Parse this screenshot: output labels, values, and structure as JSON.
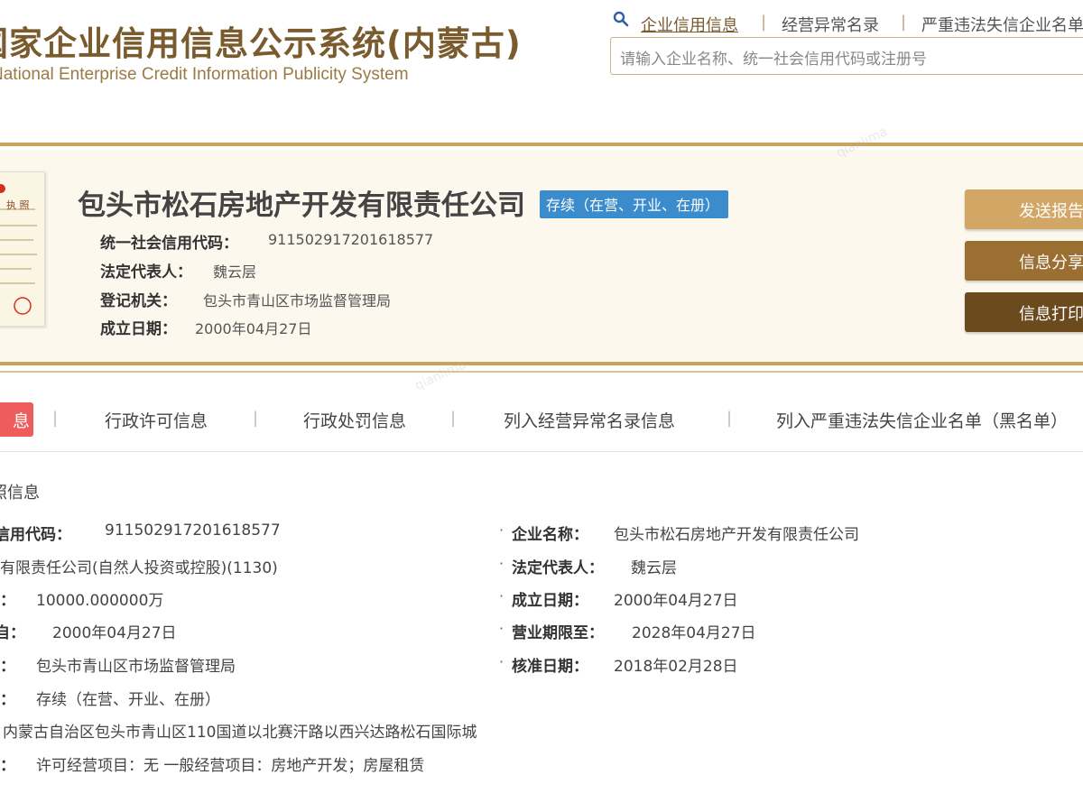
{
  "header": {
    "title": "国家企业信用信息公示系统(内蒙古)",
    "subtitle": "National Enterprise Credit Information Publicity System",
    "nav": [
      "企业信用信息",
      "经营异常名录",
      "严重违法失信企业名单"
    ],
    "search_placeholder": "请输入企业名称、统一社会信用代码或注册号"
  },
  "company": {
    "name": "包头市松石房地产开发有限责任公司",
    "status": "存续（在营、开业、在册）",
    "fields": [
      {
        "label": "统一社会信用代码：",
        "value": "911502917201618577"
      },
      {
        "label": "法定代表人：",
        "value": "魏云层"
      },
      {
        "label": "登记机关：",
        "value": "包头市青山区市场监督管理局"
      },
      {
        "label": "成立日期：",
        "value": "2000年04月27日"
      }
    ],
    "license_thumb_label": "执 照"
  },
  "actions": [
    {
      "label": "发送报告",
      "color": "#d2a766"
    },
    {
      "label": "信息分享",
      "color": "#9b6e32"
    },
    {
      "label": "信息打印",
      "color": "#6b4a1e"
    }
  ],
  "tabs": {
    "active": "息",
    "items": [
      "行政许可信息",
      "行政处罚信息",
      "列入经营异常名录信息",
      "列入严重违法失信企业名单（黑名单）"
    ]
  },
  "details": {
    "section_title": "照信息",
    "left": [
      {
        "label": "信用代码：",
        "value": "911502917201618577"
      },
      {
        "label": "",
        "value": "有限责任公司(自然人投资或控股)(1130)"
      },
      {
        "label": "：",
        "value": "10000.000000万"
      },
      {
        "label": "自：",
        "value": "2000年04月27日"
      },
      {
        "label": "：",
        "value": "包头市青山区市场监督管理局"
      },
      {
        "label": "：",
        "value": "存续（在营、开业、在册）"
      },
      {
        "label": "",
        "value": "内蒙古自治区包头市青山区110国道以北赛汗路以西兴达路松石国际城"
      },
      {
        "label": "：",
        "value": "许可经营项目：无 一般经营项目：房地产开发；房屋租赁"
      }
    ],
    "right": [
      {
        "label": "企业名称：",
        "value": "包头市松石房地产开发有限责任公司"
      },
      {
        "label": "法定代表人：",
        "value": "魏云层"
      },
      {
        "label": "成立日期：",
        "value": "2000年04月27日"
      },
      {
        "label": "营业期限至：",
        "value": "2028年04月27日"
      },
      {
        "label": "核准日期：",
        "value": "2018年02月28日"
      }
    ]
  },
  "colors": {
    "brand": "#7a5b2e",
    "gold": "#c9a35a",
    "status_badge": "#3b8ccc",
    "active_tab": "#ef5c5c"
  }
}
